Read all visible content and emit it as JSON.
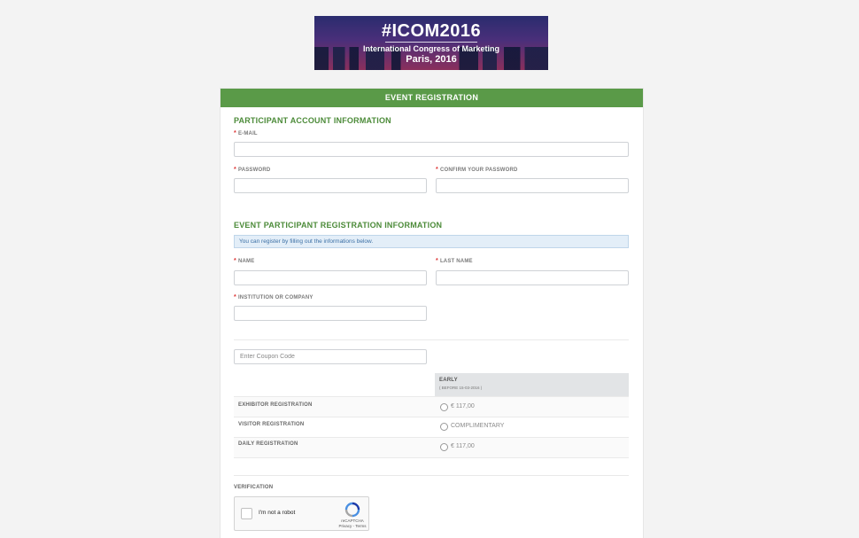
{
  "banner": {
    "hashtag": "#ICOM2016",
    "subtitle": "International Congress of Marketing",
    "location": "Paris, 2016"
  },
  "header": {
    "title": "EVENT REGISTRATION"
  },
  "account": {
    "title": "PARTICIPANT ACCOUNT INFORMATION",
    "email_label": "E-MAIL",
    "password_label": "PASSWORD",
    "confirm_label": "CONFIRM YOUR PASSWORD",
    "required_mark": "*"
  },
  "participant": {
    "title": "EVENT PARTICIPANT REGISTRATION INFORMATION",
    "info": "You can register by filling out the informations below.",
    "name_label": "NAME",
    "last_name_label": "LAST NAME",
    "institution_label": "INSTITUTION OR COMPANY"
  },
  "coupon": {
    "placeholder": "Enter Coupon Code"
  },
  "pricing": {
    "column_title": "EARLY",
    "column_sub": "( BEFORE 15-03-2016 )",
    "rows": [
      {
        "label": "EXHIBITOR REGISTRATION",
        "price": "€ 117,00"
      },
      {
        "label": "VISITOR REGISTRATION",
        "price": "COMPLIMENTARY"
      },
      {
        "label": "DAILY REGISTRATION",
        "price": "€ 117,00"
      }
    ]
  },
  "verification": {
    "label": "VERIFICATION",
    "captcha_text": "I'm not a robot",
    "captcha_brand": "reCAPTCHA",
    "captcha_links": "Privacy - Terms"
  },
  "colors": {
    "header_green": "#5a9a48",
    "section_green": "#4c8b39",
    "info_blue": "#3b6fa5"
  }
}
